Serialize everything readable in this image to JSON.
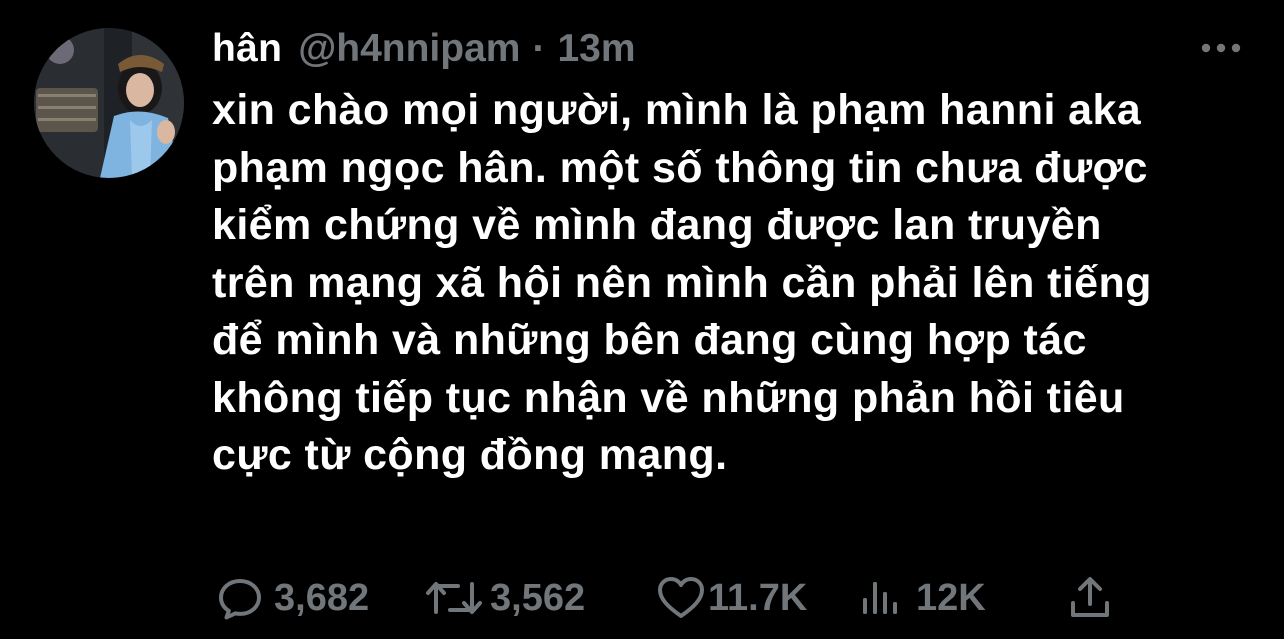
{
  "user": {
    "display_name": "hân",
    "handle": "@h4nnipam",
    "separator": "·",
    "time": "13m"
  },
  "tweet": {
    "lines": [
      "xin chào mọi người, mình là phạm hanni aka",
      "phạm ngọc hân. một số thông tin chưa được",
      "kiểm chứng về mình đang được lan truyền",
      "trên mạng xã hội nên mình cần phải lên tiếng",
      "để mình và những bên đang cùng hợp tác",
      "không tiếp tục nhận về những phản hồi tiêu",
      "cực từ cộng đồng mạng."
    ]
  },
  "actions": {
    "replies": "3,682",
    "retweets": "3,562",
    "likes": "11.7K",
    "views": "12K"
  },
  "icons": {
    "more": "more-horizontal-icon",
    "reply": "reply-icon",
    "retweet": "retweet-icon",
    "like": "heart-icon",
    "views": "views-icon",
    "share": "share-icon"
  },
  "colors": {
    "background": "#000000",
    "text": "#ffffff",
    "secondary": "#71767b"
  }
}
